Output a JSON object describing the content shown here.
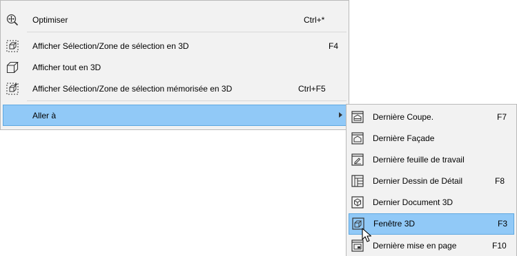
{
  "main_menu": {
    "items": [
      {
        "label": "Optimiser",
        "shortcut": "Ctrl+*"
      },
      {
        "label": "Afficher Sélection/Zone de sélection en 3D",
        "shortcut": "F4"
      },
      {
        "label": "Afficher tout en 3D",
        "shortcut": ""
      },
      {
        "label": "Afficher Sélection/Zone de sélection mémorisée en 3D",
        "shortcut": "Ctrl+F5"
      },
      {
        "label": "Aller à",
        "shortcut": ""
      }
    ]
  },
  "sub_menu": {
    "items": [
      {
        "label": "Dernière Coupe.",
        "shortcut": "F7"
      },
      {
        "label": "Dernière Façade",
        "shortcut": ""
      },
      {
        "label": "Dernière feuille de travail",
        "shortcut": ""
      },
      {
        "label": "Dernier Dessin de Détail",
        "shortcut": "F8"
      },
      {
        "label": "Dernier Document 3D",
        "shortcut": ""
      },
      {
        "label": "Fenêtre 3D",
        "shortcut": "F3"
      },
      {
        "label": "Dernière mise en page",
        "shortcut": "F10"
      }
    ]
  },
  "colors": {
    "highlight": "#91c9f7",
    "highlight_border": "#5da7e0",
    "menu_bg": "#f2f2f2"
  }
}
